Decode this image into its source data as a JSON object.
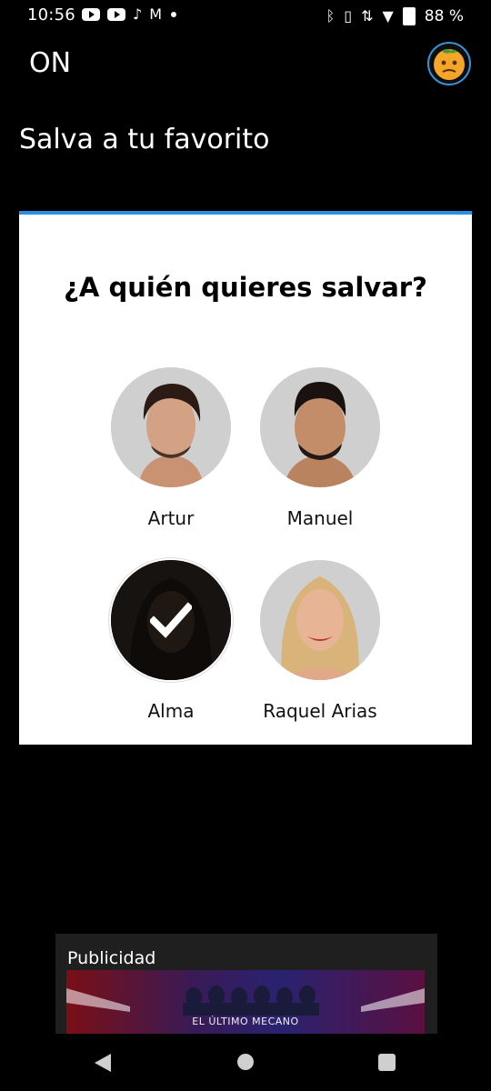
{
  "status_bar": {
    "time": "10:56",
    "battery": "88 %",
    "notification_icons": [
      "youtube-icon",
      "youtube-icon",
      "tiktok-icon",
      "gmail-icon",
      "dot-icon"
    ],
    "system_icons": [
      "bluetooth-icon",
      "vibrate-icon",
      "data-arrows-icon",
      "wifi-icon",
      "battery-icon"
    ]
  },
  "app_bar": {
    "title": "ON",
    "avatar_icon": "profile-avatar-emoji-icon"
  },
  "page": {
    "title": "Salva a tu favorito"
  },
  "poll": {
    "question": "¿A quién quieres salvar?",
    "accent_color": "#2a90e6",
    "candidates": [
      {
        "name": "Artur",
        "selected": false
      },
      {
        "name": "Manuel",
        "selected": false
      },
      {
        "name": "Alma",
        "selected": true
      },
      {
        "name": "Raquel Arias",
        "selected": false
      }
    ]
  },
  "ad": {
    "label": "Publicidad",
    "banner_text": "EL ÚLTIMO MECANO"
  },
  "nav": {
    "icons": [
      "back-icon",
      "home-icon",
      "recents-icon"
    ]
  }
}
